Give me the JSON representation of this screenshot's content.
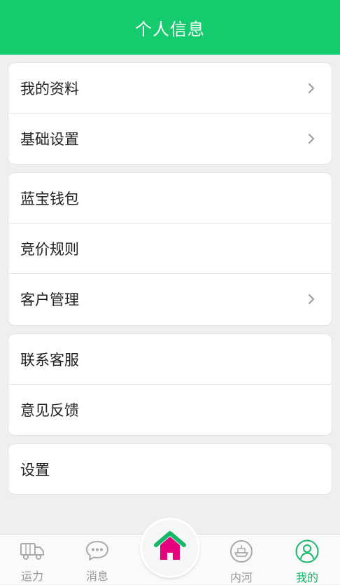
{
  "header": {
    "title": "个人信息"
  },
  "groups": [
    {
      "items": [
        {
          "label": "我的资料"
        },
        {
          "label": "基础设置"
        }
      ]
    },
    {
      "items": [
        {
          "label": "蓝宝钱包"
        },
        {
          "label": "竞价规则"
        },
        {
          "label": "客户管理"
        }
      ]
    },
    {
      "items": [
        {
          "label": "联系客服"
        },
        {
          "label": "意见反馈"
        }
      ]
    },
    {
      "items": [
        {
          "label": "设置"
        }
      ]
    }
  ],
  "tabbar": {
    "tabs": [
      {
        "label": "运力",
        "icon": "truck-icon"
      },
      {
        "label": "消息",
        "icon": "chat-bubble-icon"
      },
      {
        "label": "内河",
        "icon": "ship-icon"
      },
      {
        "label": "我的",
        "icon": "user-icon",
        "active": true
      }
    ],
    "home_icon": "home-icon"
  },
  "colors": {
    "accent": "#14cc6e",
    "active_tab": "#14b868",
    "home_roof": "#14b868",
    "home_body": "#e6007e"
  }
}
